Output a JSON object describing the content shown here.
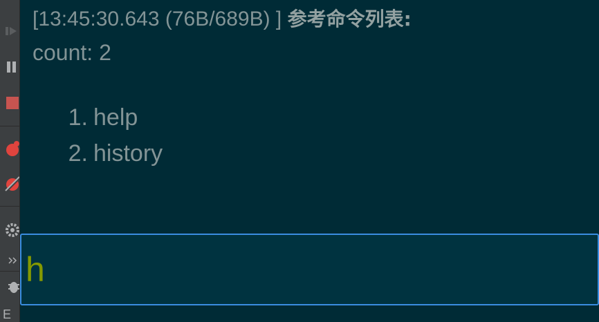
{
  "console": {
    "timestamp": "[13:45:30.643 (76B/689B) ]",
    "title": "参考命令列表:",
    "count_line": "count: 2",
    "commands": [
      {
        "num": "1.",
        "name": "help"
      },
      {
        "num": "2.",
        "name": "history"
      }
    ]
  },
  "input": {
    "value": "h"
  },
  "toolbar": {
    "items": [
      "resume-icon",
      "pause-icon",
      "stop-icon",
      "breakpoint-icon",
      "mute-breakpoints-icon",
      "settings-icon",
      "more-icon",
      "bug-icon"
    ],
    "bottom_label": "E"
  },
  "colors": {
    "background": "#002b36",
    "text": "#839496",
    "input_text": "#859900",
    "input_border": "#3b8de0",
    "stop": "#c75450",
    "breakpoint": "#e0443e"
  }
}
